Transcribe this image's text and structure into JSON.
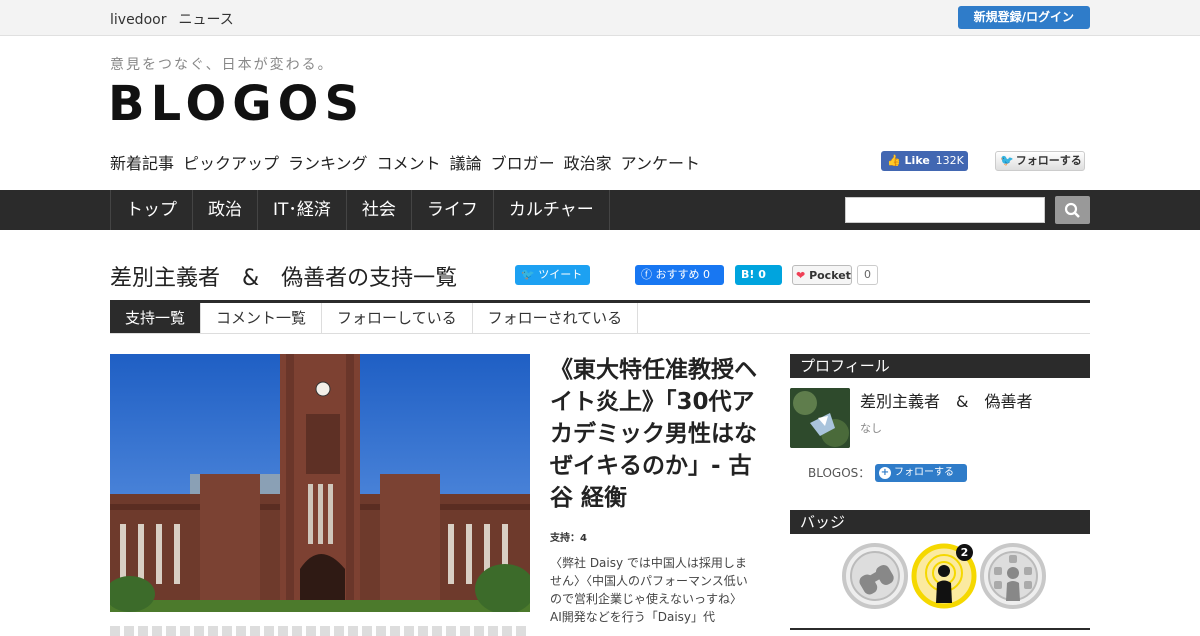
{
  "topbar": {
    "brand1": "livedoor",
    "brand2": "ニュース",
    "login": "新規登録/ログイン"
  },
  "masthead": {
    "tagline": "意見をつなぐ、日本が変わる。",
    "logo": "BLOGOS",
    "subnav": [
      "新着記事",
      "ピックアップ",
      "ランキング",
      "コメント",
      "議論",
      "ブロガー",
      "政治家",
      "アンケート"
    ],
    "fb_like": {
      "label": "Like",
      "count": "132K"
    },
    "tw_follow": "フォローする"
  },
  "mainnav": [
    "トップ",
    "政治",
    "IT･経済",
    "社会",
    "ライフ",
    "カルチャー"
  ],
  "search": {
    "placeholder": ""
  },
  "page": {
    "title": "差別主義者　&　偽善者の支持一覧",
    "share": {
      "tweet": "ツイート",
      "fb": "おすすめ 0",
      "hatena": "B! 0",
      "pocket": "Pocket",
      "pocket_count": "0"
    }
  },
  "tabs": [
    "支持一覧",
    "コメント一覧",
    "フォローしている",
    "フォローされている"
  ],
  "article": {
    "title": "《東大特任准教授ヘイト炎上》「30代アカデミック男性はなぜイキるのか」- 古谷 経衡",
    "support": "支持：4",
    "excerpt": "〈弊社 Daisy では中国人は採用しません〉〈中国人のパフォーマンス低いので営利企業じゃ使えないっすね〉　AI開発などを行う「Daisy」代"
  },
  "sidebar": {
    "profile_head": "プロフィール",
    "name": "差別主義者　&　偽善者",
    "desc": "なし",
    "blogos_label": "BLOGOS：",
    "follow": "フォローする",
    "badge_head": "バッジ",
    "badge_count": "2"
  },
  "colors": {
    "accent": "#2f7cc9",
    "nav_bg": "#2b2b2b",
    "badge_gold": "#f5d800"
  }
}
